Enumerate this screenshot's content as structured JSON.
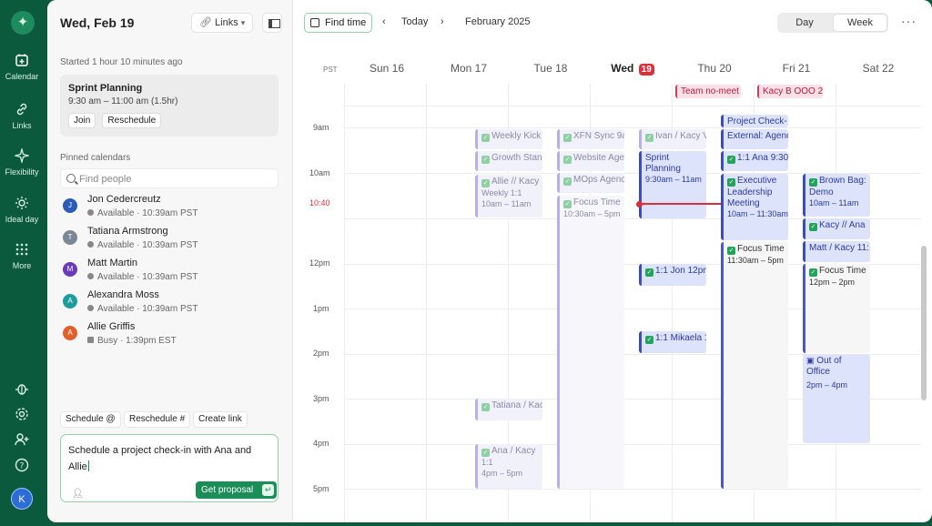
{
  "rail": {
    "items": [
      {
        "label": "Calendar",
        "icon": "calendar-plus-icon"
      },
      {
        "label": "Links",
        "icon": "link-icon"
      },
      {
        "label": "Flexibility",
        "icon": "sparkle-icon"
      },
      {
        "label": "Ideal day",
        "icon": "sun-icon"
      },
      {
        "label": "More",
        "icon": "grid-dots-icon"
      }
    ],
    "user_initial": "K"
  },
  "sidebar": {
    "date_title": "Wed, Feb 19",
    "links_label": "Links",
    "started_text": "Started 1 hour 10 minutes ago",
    "meeting": {
      "title": "Sprint Planning",
      "time": "9:30 am – 11:00 am (1.5hr)",
      "join_label": "Join",
      "reschedule_label": "Reschedule"
    },
    "pinned_label": "Pinned calendars",
    "search_placeholder": "Find people",
    "people": [
      {
        "initial": "J",
        "name": "Jon Cedercreutz",
        "status": "Available · 10:39am PST",
        "color": "#2b5cb8"
      },
      {
        "initial": "T",
        "name": "Tatiana Armstrong",
        "status": "Available · 10:39am PST",
        "color": "#7a8794"
      },
      {
        "initial": "M",
        "name": "Matt Martin",
        "status": "Available · 10:39am PST",
        "color": "#6a3ab8"
      },
      {
        "initial": "A",
        "name": "Alexandra Moss",
        "status": "Available · 10:39am PST",
        "color": "#1e9c9c"
      },
      {
        "initial": "A",
        "name": "Allie Griffis",
        "status": "Busy · 1:39pm EST",
        "color": "#e0602c"
      }
    ],
    "quick_actions": [
      "Schedule @",
      "Reschedule #",
      "Create link"
    ],
    "compose_text_1": "Schedule a project check-in with Ana and",
    "compose_text_2": "Allie",
    "proposal_label": "Get proposal"
  },
  "header": {
    "find_time_label": "Find time",
    "today_label": "Today",
    "month_label": "February 2025",
    "view_day": "Day",
    "view_week": "Week",
    "selected_view": "Week"
  },
  "calendar": {
    "timezone": "PST",
    "days": [
      "Sun 16",
      "Mon 17",
      "Tue 18",
      "Wed",
      "Thu 20",
      "Fri 21",
      "Sat 22"
    ],
    "today_badge": "19",
    "hours": [
      "9am",
      "10am",
      "12pm",
      "1pm",
      "2pm",
      "3pm",
      "4pm",
      "5pm"
    ],
    "now_label": "10:40",
    "all_day": [
      {
        "title": "Team no-meet"
      },
      {
        "title": "Kacy B OOO 2"
      }
    ],
    "events": {
      "mon_weekly": "Weekly Kick",
      "mon_growth": "Growth Stan",
      "mon_allie": "Allie // Kacy",
      "mon_allie_sub": "Weekly 1:1",
      "mon_allie_time": "10am – 11am",
      "mon_tatiana": "Tatiana / Kac",
      "mon_ana": "Ana / Kacy",
      "mon_ana_sub": "1:1",
      "mon_ana_time": "4pm – 5pm",
      "tue_xfn": "XFN Sync",
      "tue_xfn_time": "9a",
      "tue_web": "Website Age",
      "tue_mops": "MOps Agenc",
      "tue_focus": "Focus Time",
      "tue_focus_time": "10:30am – 5pm",
      "wed_ivan": "Ivan / Kacy V",
      "wed_sprint": "Sprint",
      "wed_sprint_2": "Planning",
      "wed_sprint_time": "9:30am – 11am",
      "wed_jon": "1:1 Jon",
      "wed_jon_time": "12pm",
      "wed_mikaela": "1:1 Mikaela 1",
      "thu_project": "Project Check-",
      "thu_external": "External: Agenc",
      "thu_ana": "1:1 Ana",
      "thu_ana_time": "9:30a",
      "thu_exec": "Executive",
      "thu_exec_2": "Leadership",
      "thu_exec_3": "Meeting",
      "thu_exec_time": "10am – 11:30am",
      "thu_focus": "Focus Time",
      "thu_focus_time": "11:30am – 5pm",
      "fri_brown": "Brown Bag:",
      "fri_brown_2": "Demo",
      "fri_brown_time": "10am – 11am",
      "fri_kacy": "Kacy // Ana",
      "fri_matt": "Matt / Kacy",
      "fri_matt_time": "11:",
      "fri_focus": "Focus Time",
      "fri_focus_time": "12pm – 2pm",
      "fri_ooo": "Out of",
      "fri_ooo_2": "Office",
      "fri_ooo_time": "2pm – 4pm"
    }
  }
}
